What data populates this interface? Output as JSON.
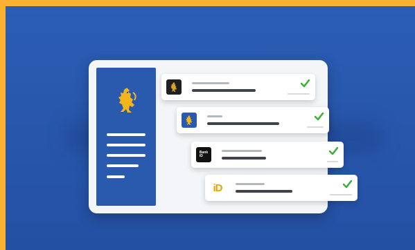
{
  "logos": {
    "bankid_text": "Bank iD",
    "id_text": "iD"
  },
  "icons": {
    "side_emblem": "lion-crest-icon",
    "verified": "checkmark-icon"
  },
  "colors": {
    "frame": "#fbb232",
    "background": "#2b5db5",
    "sidebar": "#2a5aae",
    "check": "#3fae3a",
    "gold": "#e8a300"
  },
  "providers": [
    {
      "logo": "lion-crest-icon",
      "verified": true
    },
    {
      "logo": "lion-crest-icon",
      "verified": true
    },
    {
      "logo": "bankid-icon",
      "verified": true
    },
    {
      "logo": "id-icon",
      "verified": true
    }
  ]
}
